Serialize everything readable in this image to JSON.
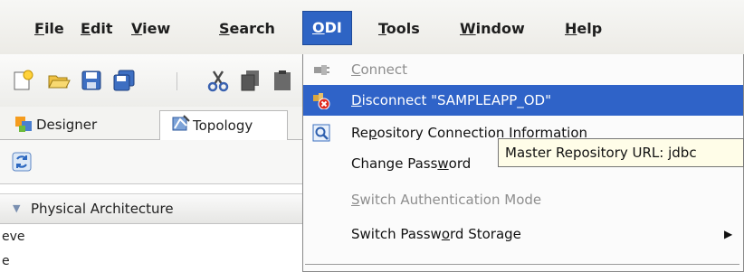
{
  "menubar": {
    "items": [
      {
        "label": "File",
        "mnemonic": "F",
        "rest": "ile"
      },
      {
        "label": "Edit",
        "mnemonic": "E",
        "rest": "dit"
      },
      {
        "label": "View",
        "mnemonic": "V",
        "rest": "iew"
      },
      {
        "label": "Search",
        "mnemonic": "S",
        "rest": "earch"
      },
      {
        "label": "ODI",
        "mnemonic": "O",
        "rest": "DI"
      },
      {
        "label": "Tools",
        "mnemonic": "T",
        "rest": "ools"
      },
      {
        "label": "Window",
        "mnemonic": "W",
        "rest": "indow"
      },
      {
        "label": "Help",
        "mnemonic": "H",
        "rest": "elp"
      }
    ]
  },
  "tabs": [
    {
      "label": "Designer",
      "icon": "designer-icon"
    },
    {
      "label": "Topology",
      "icon": "topology-icon"
    }
  ],
  "section": {
    "label": "Physical Architecture"
  },
  "tree": [
    "eve",
    "e"
  ],
  "odi_menu": {
    "items": [
      {
        "pre": "",
        "mn": "C",
        "post": "onnect",
        "state": "disabled",
        "icon": "connect-icon"
      },
      {
        "pre": "",
        "mn": "D",
        "post": "isconnect \"SAMPLEAPP_OD\"",
        "state": "highlighted",
        "icon": "disconnect-icon"
      },
      {
        "pre": "Re",
        "mn": "p",
        "post": "ository Connection Information",
        "state": "enabled",
        "icon": "repository-search-icon"
      },
      {
        "pre": "Change Pass",
        "mn": "w",
        "post": "ord",
        "state": "enabled",
        "icon": ""
      },
      {
        "pre": "",
        "mn": "S",
        "post": "witch Authentication Mode",
        "state": "disabled",
        "icon": ""
      },
      {
        "pre": "Switch Passw",
        "mn": "o",
        "post": "rd Storage",
        "state": "enabled",
        "icon": "",
        "submenu": true
      }
    ]
  },
  "tooltip": {
    "text": "Master Repository URL: jdbc"
  }
}
